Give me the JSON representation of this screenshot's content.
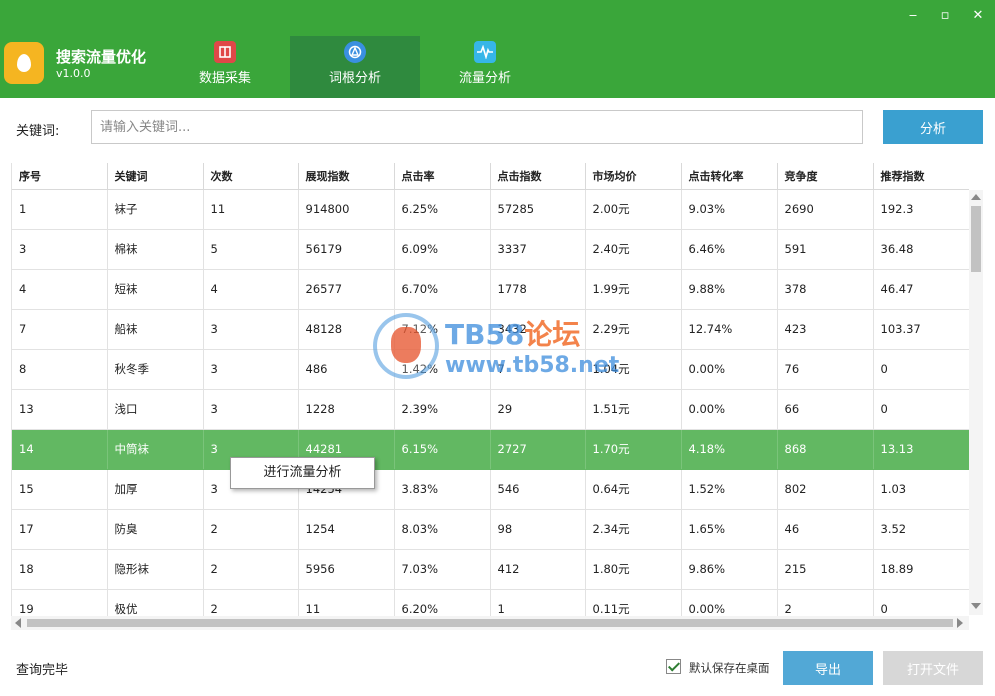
{
  "app": {
    "title": "搜索流量优化",
    "version": "v1.0.0"
  },
  "window": {
    "minimize": "‒",
    "maximize": "▫",
    "close": "✕"
  },
  "tabs": [
    {
      "label": "数据采集",
      "icon": "book-icon",
      "color": "#e04848"
    },
    {
      "label": "词根分析",
      "icon": "compass-icon",
      "color": "#3a90e0",
      "active": true
    },
    {
      "label": "流量分析",
      "icon": "pulse-icon",
      "color": "#36b6e8"
    }
  ],
  "search": {
    "label": "关键词:",
    "placeholder": "请输入关键词...",
    "button": "分析"
  },
  "table": {
    "columns": [
      "序号",
      "关键词",
      "次数",
      "展现指数",
      "点击率",
      "点击指数",
      "市场均价",
      "点击转化率",
      "竞争度",
      "推荐指数"
    ],
    "rows": [
      [
        "1",
        "袜子",
        "11",
        "914800",
        "6.25%",
        "57285",
        "2.00元",
        "9.03%",
        "2690",
        "192.3"
      ],
      [
        "3",
        "棉袜",
        "5",
        "56179",
        "6.09%",
        "3337",
        "2.40元",
        "6.46%",
        "591",
        "36.48"
      ],
      [
        "4",
        "短袜",
        "4",
        "26577",
        "6.70%",
        "1778",
        "1.99元",
        "9.88%",
        "378",
        "46.47"
      ],
      [
        "7",
        "船袜",
        "3",
        "48128",
        "7.12%",
        "3432",
        "2.29元",
        "12.74%",
        "423",
        "103.37"
      ],
      [
        "8",
        "秋冬季",
        "3",
        "486",
        "1.42%",
        "7",
        "1.04元",
        "0.00%",
        "76",
        "0"
      ],
      [
        "13",
        "浅口",
        "3",
        "1228",
        "2.39%",
        "29",
        "1.51元",
        "0.00%",
        "66",
        "0"
      ],
      [
        "14",
        "中筒袜",
        "3",
        "44281",
        "6.15%",
        "2727",
        "1.70元",
        "4.18%",
        "868",
        "13.13"
      ],
      [
        "15",
        "加厚",
        "3",
        "14254",
        "3.83%",
        "546",
        "0.64元",
        "1.52%",
        "802",
        "1.03"
      ],
      [
        "17",
        "防臭",
        "2",
        "1254",
        "8.03%",
        "98",
        "2.34元",
        "1.65%",
        "46",
        "3.52"
      ],
      [
        "18",
        "隐形袜",
        "2",
        "5956",
        "7.03%",
        "412",
        "1.80元",
        "9.86%",
        "215",
        "18.89"
      ],
      [
        "19",
        "极优",
        "2",
        "11",
        "6.20%",
        "1",
        "0.11元",
        "0.00%",
        "2",
        "0"
      ]
    ],
    "selected_row": 6
  },
  "context_menu": {
    "item": "进行流量分析"
  },
  "watermark": {
    "title": "TB58",
    "title_cn": "论坛",
    "url": "www.tb58.net"
  },
  "footer": {
    "status": "查询完毕",
    "checkbox_label": "默认保存在桌面",
    "checkbox_checked": true,
    "export": "导出",
    "open_file": "打开文件"
  }
}
